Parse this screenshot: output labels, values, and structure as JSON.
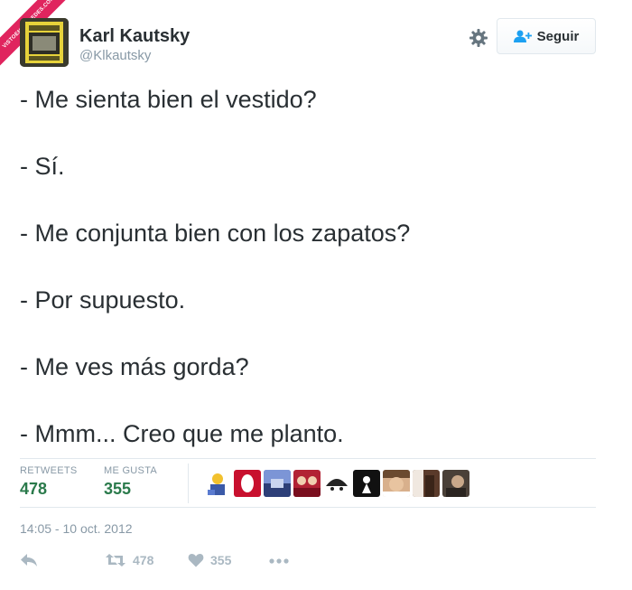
{
  "watermark": {
    "text": "VISTOENLASREDES.COM"
  },
  "user": {
    "name": "Karl Kautsky",
    "handle": "@Klkautsky",
    "avatar_icon": "book-cover-avatar"
  },
  "header": {
    "follow_label": "Seguir",
    "gear_icon": "gear-icon",
    "follow_icon": "add-user-icon"
  },
  "tweet": {
    "lines": [
      "- Me sienta bien el vestido?",
      "- Sí.",
      "- Me conjunta bien con los zapatos?",
      "- Por supuesto.",
      "- Me ves más gorda?",
      "- Mmm... Creo que me planto."
    ],
    "timestamp": "14:05 - 10 oct. 2012"
  },
  "stats": {
    "retweets_label": "RETWEETS",
    "retweets_value": "478",
    "likes_label": "ME GUSTA",
    "likes_value": "355",
    "value_color": "#2a7a4b"
  },
  "liker_avatars": [
    "liker-avatar-1",
    "liker-avatar-2",
    "liker-avatar-3",
    "liker-avatar-4",
    "liker-avatar-5",
    "liker-avatar-6",
    "liker-avatar-7",
    "liker-avatar-8",
    "liker-avatar-9"
  ],
  "actions": {
    "reply_icon": "reply-icon",
    "retweet_icon": "retweet-icon",
    "retweet_count": "478",
    "like_icon": "heart-icon",
    "like_count": "355",
    "more_icon": "more-icon"
  }
}
